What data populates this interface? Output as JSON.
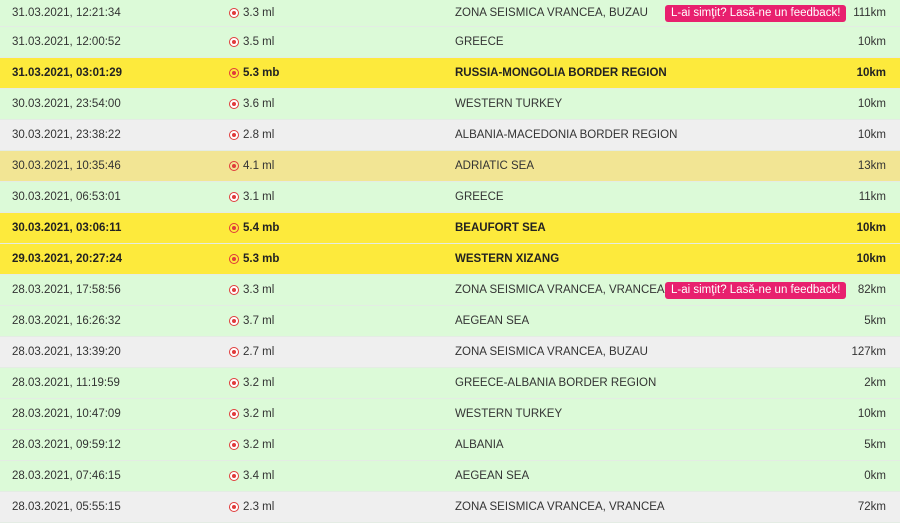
{
  "feedback_label": "L-ai simţit? Lasă-ne un feedback!",
  "colors": {
    "green": "#dcfad8",
    "gray": "#efefef",
    "khaki": "#f2e594",
    "yellow": "#fdea3c",
    "feedback": "#e8206e",
    "magnitude_icon": "#e03b3b"
  },
  "rows": [
    {
      "time": "31.03.2021, 12:21:34",
      "mag": "3.3 ml",
      "region": "ZONA SEISMICA VRANCEA, BUZAU",
      "depth": "111km",
      "style": "green",
      "feedback": true
    },
    {
      "time": "31.03.2021, 12:00:52",
      "mag": "3.5 ml",
      "region": "GREECE",
      "depth": "10km",
      "style": "green",
      "feedback": false
    },
    {
      "time": "31.03.2021, 03:01:29",
      "mag": "5.3 mb",
      "region": "RUSSIA-MONGOLIA BORDER REGION",
      "depth": "10km",
      "style": "yellow",
      "feedback": false
    },
    {
      "time": "30.03.2021, 23:54:00",
      "mag": "3.6 ml",
      "region": "WESTERN TURKEY",
      "depth": "10km",
      "style": "green",
      "feedback": false
    },
    {
      "time": "30.03.2021, 23:38:22",
      "mag": "2.8 ml",
      "region": "ALBANIA-MACEDONIA BORDER REGION",
      "depth": "10km",
      "style": "gray",
      "feedback": false
    },
    {
      "time": "30.03.2021, 10:35:46",
      "mag": "4.1 ml",
      "region": "ADRIATIC SEA",
      "depth": "13km",
      "style": "khaki",
      "feedback": false
    },
    {
      "time": "30.03.2021, 06:53:01",
      "mag": "3.1 ml",
      "region": "GREECE",
      "depth": "11km",
      "style": "green",
      "feedback": false
    },
    {
      "time": "30.03.2021, 03:06:11",
      "mag": "5.4 mb",
      "region": "BEAUFORT SEA",
      "depth": "10km",
      "style": "yellow",
      "feedback": false
    },
    {
      "time": "29.03.2021, 20:27:24",
      "mag": "5.3 mb",
      "region": "WESTERN XIZANG",
      "depth": "10km",
      "style": "yellow",
      "feedback": false
    },
    {
      "time": "28.03.2021, 17:58:56",
      "mag": "3.3 ml",
      "region": "ZONA SEISMICA VRANCEA, VRANCEA",
      "depth": "82km",
      "style": "green",
      "feedback": true
    },
    {
      "time": "28.03.2021, 16:26:32",
      "mag": "3.7 ml",
      "region": "AEGEAN SEA",
      "depth": "5km",
      "style": "green",
      "feedback": false
    },
    {
      "time": "28.03.2021, 13:39:20",
      "mag": "2.7 ml",
      "region": "ZONA SEISMICA VRANCEA, BUZAU",
      "depth": "127km",
      "style": "gray",
      "feedback": false
    },
    {
      "time": "28.03.2021, 11:19:59",
      "mag": "3.2 ml",
      "region": "GREECE-ALBANIA BORDER REGION",
      "depth": "2km",
      "style": "green",
      "feedback": false
    },
    {
      "time": "28.03.2021, 10:47:09",
      "mag": "3.2 ml",
      "region": "WESTERN TURKEY",
      "depth": "10km",
      "style": "green",
      "feedback": false
    },
    {
      "time": "28.03.2021, 09:59:12",
      "mag": "3.2 ml",
      "region": "ALBANIA",
      "depth": "5km",
      "style": "green",
      "feedback": false
    },
    {
      "time": "28.03.2021, 07:46:15",
      "mag": "3.4 ml",
      "region": "AEGEAN SEA",
      "depth": "0km",
      "style": "green",
      "feedback": false
    },
    {
      "time": "28.03.2021, 05:55:15",
      "mag": "2.3 ml",
      "region": "ZONA SEISMICA VRANCEA, VRANCEA",
      "depth": "72km",
      "style": "gray",
      "feedback": false
    }
  ]
}
